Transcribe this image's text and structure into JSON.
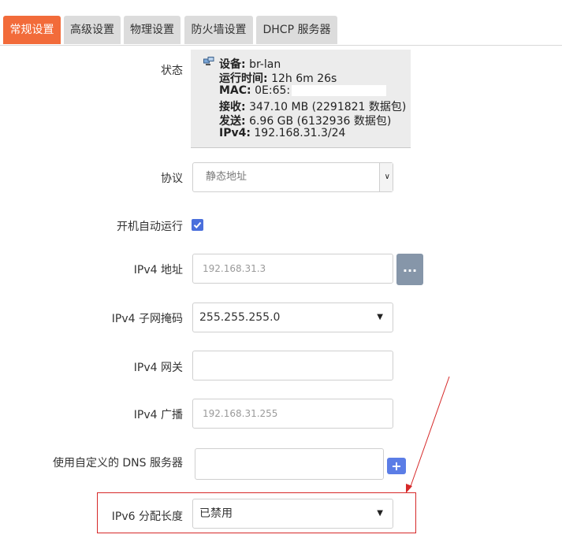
{
  "tabs": [
    "常规设置",
    "高级设置",
    "物理设置",
    "防火墙设置",
    "DHCP 服务器"
  ],
  "status": {
    "label": "状态",
    "device_key": "设备:",
    "device_val": "br-lan",
    "uptime_key": "运行时间:",
    "uptime_val": "12h 6m 26s",
    "mac_key": "MAC:",
    "mac_val": "0E:65:",
    "rx_key": "接收:",
    "rx_val": "347.10 MB (2291821 数据包)",
    "tx_key": "发送:",
    "tx_val": "6.96 GB (6132936 数据包)",
    "ipv4_key": "IPv4:",
    "ipv4_val": "192.168.31.3/24"
  },
  "protocol": {
    "label": "协议",
    "value": "静态地址"
  },
  "autostart": {
    "label": "开机自动运行",
    "checked": true
  },
  "ipv4_addr": {
    "label": "IPv4 地址",
    "placeholder": "192.168.31.3",
    "button": "..."
  },
  "netmask": {
    "label": "IPv4 子网掩码",
    "value": "255.255.255.0"
  },
  "gateway": {
    "label": "IPv4 网关",
    "value": ""
  },
  "broadcast": {
    "label": "IPv4 广播",
    "placeholder": "192.168.31.255"
  },
  "dns": {
    "label": "使用自定义的 DNS 服务器",
    "button": "+"
  },
  "ipv6_prefix": {
    "label": "IPv6 分配长度",
    "value": "已禁用"
  },
  "colors": {
    "active_tab": "#f26b3a",
    "highlight": "#d62828",
    "checkbox": "#4a6fdc"
  }
}
